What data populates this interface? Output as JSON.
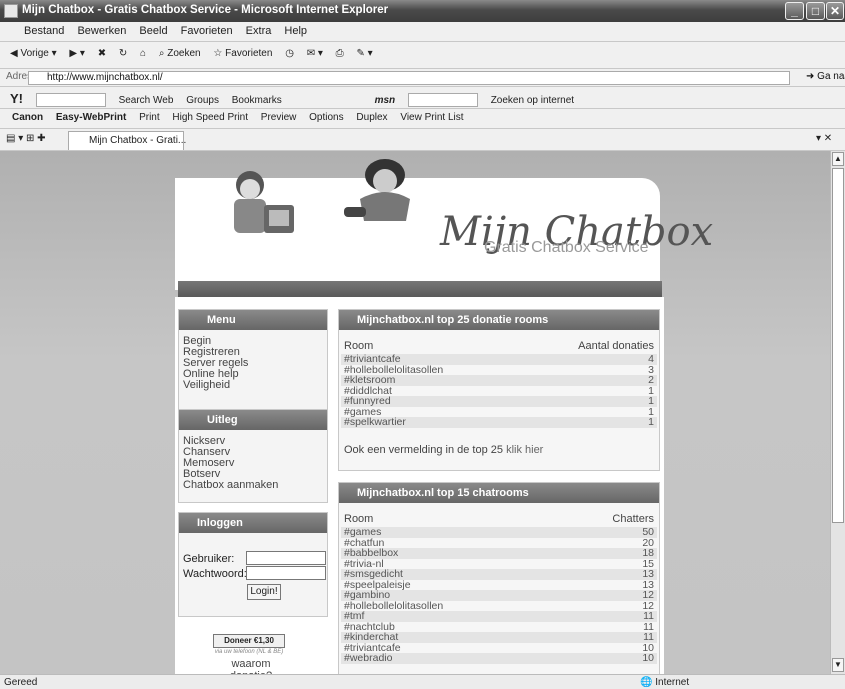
{
  "window": {
    "title": "Mijn Chatbox - Gratis Chatbox Service - Microsoft Internet Explorer"
  },
  "menu": [
    "Bestand",
    "Bewerken",
    "Beeld",
    "Favorieten",
    "Extra",
    "Help"
  ],
  "toolbar": {
    "back": "Vorige",
    "search": "Zoeken",
    "favorites": "Favorieten"
  },
  "address": {
    "label": "Adres",
    "url": "http://www.mijnchatbox.nl/",
    "go": "Ga naar"
  },
  "yahoo": {
    "logo": "Y!",
    "search_web": "Search Web",
    "groups": "Groups",
    "bookmarks": "Bookmarks",
    "msn": "msn",
    "search_internet": "Zoeken op internet"
  },
  "canon": {
    "brand": "Canon",
    "product": "Easy-WebPrint",
    "print": "Print",
    "hsprint": "High Speed Print",
    "preview": "Preview",
    "options": "Options",
    "duplex": "Duplex",
    "printlist": "View Print List"
  },
  "tab": {
    "label": "Mijn Chatbox - Grati..."
  },
  "status": {
    "left": "Gereed",
    "zone": "Internet"
  },
  "logo": {
    "title": "Mijn Chatbox",
    "subtitle": "Gratis Chatbox Service"
  },
  "menu_panel": {
    "title": "Menu",
    "items": [
      "Begin",
      "Registreren",
      "Server regels",
      "Online help",
      "Veiligheid"
    ]
  },
  "uitleg_panel": {
    "title": "Uitleg",
    "items": [
      "Nickserv",
      "Chanserv",
      "Memoserv",
      "Botserv",
      "Chatbox aanmaken"
    ]
  },
  "login": {
    "title": "Inloggen",
    "user_label": "Gebruiker:",
    "pass_label": "Wachtwoord:",
    "button": "Login!"
  },
  "donate": {
    "button": "Doneer €1,30",
    "sub": "via uw telefoon (NL & BE)",
    "why": "waarom donatie?"
  },
  "donatie": {
    "title": "Mijnchatbox.nl top 25 donatie rooms",
    "col_room": "Room",
    "col_count": "Aantal donaties",
    "rows": [
      {
        "room": "#triviantcafe",
        "n": "4"
      },
      {
        "room": "#hollebollelolitasollen",
        "n": "3"
      },
      {
        "room": "#kletsroom",
        "n": "2"
      },
      {
        "room": "#diddlchat",
        "n": "1"
      },
      {
        "room": "#funnyred",
        "n": "1"
      },
      {
        "room": "#games",
        "n": "1"
      },
      {
        "room": "#spelkwartier",
        "n": "1"
      }
    ],
    "footer_text": "Ook een vermelding in de top 25",
    "footer_link": "klik hier"
  },
  "chatrooms": {
    "title": "Mijnchatbox.nl top 15 chatrooms",
    "col_room": "Room",
    "col_count": "Chatters",
    "rows": [
      {
        "room": "#games",
        "n": "50"
      },
      {
        "room": "#chatfun",
        "n": "20"
      },
      {
        "room": "#babbelbox",
        "n": "18"
      },
      {
        "room": "#trivia-nl",
        "n": "15"
      },
      {
        "room": "#smsgedicht",
        "n": "13"
      },
      {
        "room": "#speelpaleisje",
        "n": "13"
      },
      {
        "room": "#gambino",
        "n": "12"
      },
      {
        "room": "#hollebollelolitasollen",
        "n": "12"
      },
      {
        "room": "#tmf",
        "n": "11"
      },
      {
        "room": "#nachtclub",
        "n": "11"
      },
      {
        "room": "#kinderchat",
        "n": "11"
      },
      {
        "room": "#triviantcafe",
        "n": "10"
      },
      {
        "room": "#webradio",
        "n": "10"
      }
    ]
  }
}
